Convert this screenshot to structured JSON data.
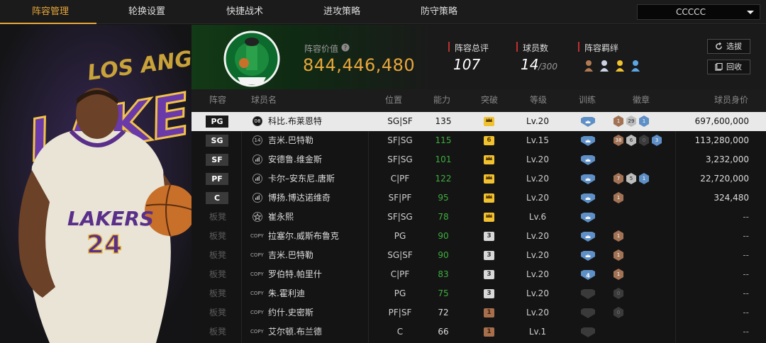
{
  "tabs": [
    {
      "label": "阵容管理",
      "active": true
    },
    {
      "label": "轮换设置",
      "active": false
    },
    {
      "label": "快捷战术",
      "active": false
    },
    {
      "label": "进攻策略",
      "active": false
    },
    {
      "label": "防守策略",
      "active": false
    }
  ],
  "team_select": {
    "value": "CCCCC"
  },
  "header": {
    "lineup_value_label": "阵容价值",
    "lineup_value": "844,446,480",
    "rating_label": "阵容总评",
    "rating": "107",
    "players_label": "球员数",
    "players_count": "14",
    "players_max": "/300",
    "bond_label": "阵容羁绊",
    "select_button": "选拔",
    "recycle_button": "回收"
  },
  "columns": [
    "阵容",
    "球员名",
    "位置",
    "能力",
    "突破",
    "等级",
    "训练",
    "徽章",
    "球员身价"
  ],
  "colors": {
    "accent": "#e8a73a",
    "ability_green": "#3fae3f",
    "selected_row": "#e9e9e9"
  },
  "rows": [
    {
      "slot": "PG",
      "card": "08",
      "name": "科比.布莱恩特",
      "position": "SG|SF",
      "ability": "135",
      "ability_color": "white",
      "breakthrough": "crown",
      "breakthrough_style": "gold",
      "level": "Lv.20",
      "training": "crown",
      "badges": [
        {
          "v": "1",
          "t": "bronze"
        },
        {
          "v": "29",
          "t": "silver"
        },
        {
          "v": "1",
          "t": "blue"
        }
      ],
      "value": "697,600,000",
      "selected": true
    },
    {
      "slot": "SG",
      "card": "14",
      "name": "吉米.巴特勒",
      "position": "SF|SG",
      "ability": "115",
      "ability_color": "green",
      "breakthrough": "6",
      "breakthrough_style": "gold",
      "level": "Lv.15",
      "training": "crown",
      "badges": [
        {
          "v": "38",
          "t": "bronze"
        },
        {
          "v": "6",
          "t": "silver"
        },
        {
          "v": "0",
          "t": "dark"
        },
        {
          "v": "3",
          "t": "blue"
        }
      ],
      "value": "113,280,000"
    },
    {
      "slot": "SF",
      "card": "bars",
      "name": "安德鲁.维金斯",
      "position": "SF|SG",
      "ability": "101",
      "ability_color": "green",
      "breakthrough": "crown",
      "breakthrough_style": "gold",
      "level": "Lv.20",
      "training": "crown",
      "badges": [],
      "value": "3,232,000"
    },
    {
      "slot": "PF",
      "card": "bars",
      "name": "卡尔–安东尼.唐斯",
      "position": "C|PF",
      "ability": "122",
      "ability_color": "green",
      "breakthrough": "crown",
      "breakthrough_style": "gold",
      "level": "Lv.20",
      "training": "crown",
      "badges": [
        {
          "v": "7",
          "t": "bronze"
        },
        {
          "v": "5",
          "t": "silver"
        },
        {
          "v": "1",
          "t": "blue"
        }
      ],
      "value": "22,720,000"
    },
    {
      "slot": "C",
      "card": "bars",
      "name": "博扬.博达诺维奇",
      "position": "SF|PF",
      "ability": "95",
      "ability_color": "green",
      "breakthrough": "crown",
      "breakthrough_style": "gold",
      "level": "Lv.20",
      "training": "crown",
      "badges": [
        {
          "v": "1",
          "t": "bronze"
        }
      ],
      "value": "324,480"
    },
    {
      "slot": "板凳",
      "card": "star",
      "name": "崔永熙",
      "position": "SF|SG",
      "ability": "78",
      "ability_color": "green",
      "breakthrough": "crown",
      "breakthrough_style": "gold",
      "level": "Lv.6",
      "training": "crown",
      "badges": [],
      "value": "--"
    },
    {
      "slot": "板凳",
      "card": "COPY",
      "name": "拉塞尔.威斯布鲁克",
      "position": "PG",
      "ability": "90",
      "ability_color": "green",
      "breakthrough": "3",
      "breakthrough_style": "gray",
      "level": "Lv.20",
      "training": "crown",
      "badges": [
        {
          "v": "1",
          "t": "bronze"
        }
      ],
      "value": "--"
    },
    {
      "slot": "板凳",
      "card": "COPY",
      "name": "吉米.巴特勒",
      "position": "SG|SF",
      "ability": "90",
      "ability_color": "green",
      "breakthrough": "3",
      "breakthrough_style": "gray",
      "level": "Lv.20",
      "training": "crown",
      "badges": [
        {
          "v": "1",
          "t": "bronze"
        }
      ],
      "value": "--"
    },
    {
      "slot": "板凳",
      "card": "COPY",
      "name": "罗伯特.帕里什",
      "position": "C|PF",
      "ability": "83",
      "ability_color": "green",
      "breakthrough": "3",
      "breakthrough_style": "gray",
      "level": "Lv.20",
      "training": "4",
      "badges": [
        {
          "v": "1",
          "t": "bronze"
        }
      ],
      "value": "--"
    },
    {
      "slot": "板凳",
      "card": "COPY",
      "name": "朱.霍利迪",
      "position": "PG",
      "ability": "75",
      "ability_color": "green",
      "breakthrough": "3",
      "breakthrough_style": "gray",
      "level": "Lv.20",
      "training": "dim",
      "badges": [
        {
          "v": "0",
          "t": "dark"
        }
      ],
      "value": "--"
    },
    {
      "slot": "板凳",
      "card": "COPY",
      "name": "约什.史密斯",
      "position": "PF|SF",
      "ability": "72",
      "ability_color": "white",
      "breakthrough": "1",
      "breakthrough_style": "bronze",
      "level": "Lv.20",
      "training": "dim",
      "badges": [
        {
          "v": "0",
          "t": "dark"
        }
      ],
      "value": "--"
    },
    {
      "slot": "板凳",
      "card": "COPY",
      "name": "艾尔顿.布兰德",
      "position": "C",
      "ability": "66",
      "ability_color": "white",
      "breakthrough": "1",
      "breakthrough_style": "bronze",
      "level": "Lv.1",
      "training": "dim",
      "badges": [],
      "value": "--"
    }
  ]
}
